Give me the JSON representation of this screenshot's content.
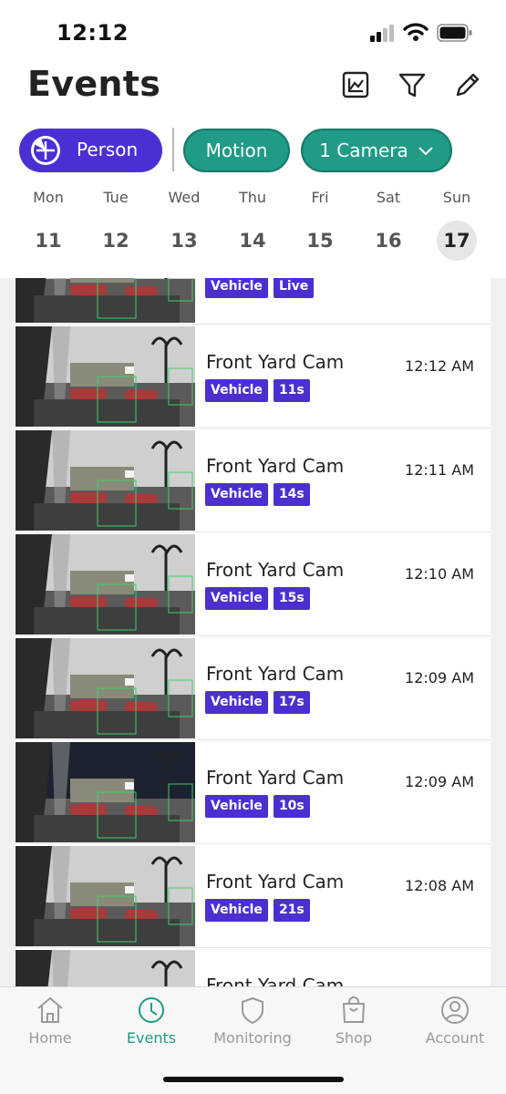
{
  "status_bar": {
    "time": "12:12"
  },
  "header": {
    "title": "Events",
    "icons": [
      "chart-icon",
      "filter-icon",
      "edit-icon"
    ]
  },
  "filters": {
    "person": "Person",
    "motion": "Motion",
    "camera": "1 Camera"
  },
  "colors": {
    "accent_purple": "#4b2fd3",
    "accent_teal": "#1f9b86"
  },
  "week": [
    {
      "dow": "Mon",
      "num": "11"
    },
    {
      "dow": "Tue",
      "num": "12"
    },
    {
      "dow": "Wed",
      "num": "13"
    },
    {
      "dow": "Thu",
      "num": "14"
    },
    {
      "dow": "Fri",
      "num": "15"
    },
    {
      "dow": "Sat",
      "num": "16"
    },
    {
      "dow": "Sun",
      "num": "17"
    }
  ],
  "selected_day": "17",
  "events": [
    {
      "camera": "",
      "tags": [
        "Vehicle",
        "Live"
      ],
      "time": ""
    },
    {
      "camera": "Front Yard Cam",
      "tags": [
        "Vehicle",
        "11s"
      ],
      "time": "12:12 AM"
    },
    {
      "camera": "Front Yard Cam",
      "tags": [
        "Vehicle",
        "14s"
      ],
      "time": "12:11 AM"
    },
    {
      "camera": "Front Yard Cam",
      "tags": [
        "Vehicle",
        "15s"
      ],
      "time": "12:10 AM"
    },
    {
      "camera": "Front Yard Cam",
      "tags": [
        "Vehicle",
        "17s"
      ],
      "time": "12:09 AM"
    },
    {
      "camera": "Front Yard Cam",
      "tags": [
        "Vehicle",
        "10s"
      ],
      "time": "12:09 AM"
    },
    {
      "camera": "Front Yard Cam",
      "tags": [
        "Vehicle",
        "21s"
      ],
      "time": "12:08 AM"
    },
    {
      "camera": "Front Yard Cam",
      "tags": [],
      "time": ""
    }
  ],
  "tabs": [
    {
      "label": "Home",
      "icon": "home-icon"
    },
    {
      "label": "Events",
      "icon": "clock-icon"
    },
    {
      "label": "Monitoring",
      "icon": "shield-icon"
    },
    {
      "label": "Shop",
      "icon": "bag-icon"
    },
    {
      "label": "Account",
      "icon": "account-icon"
    }
  ],
  "active_tab": "Events"
}
